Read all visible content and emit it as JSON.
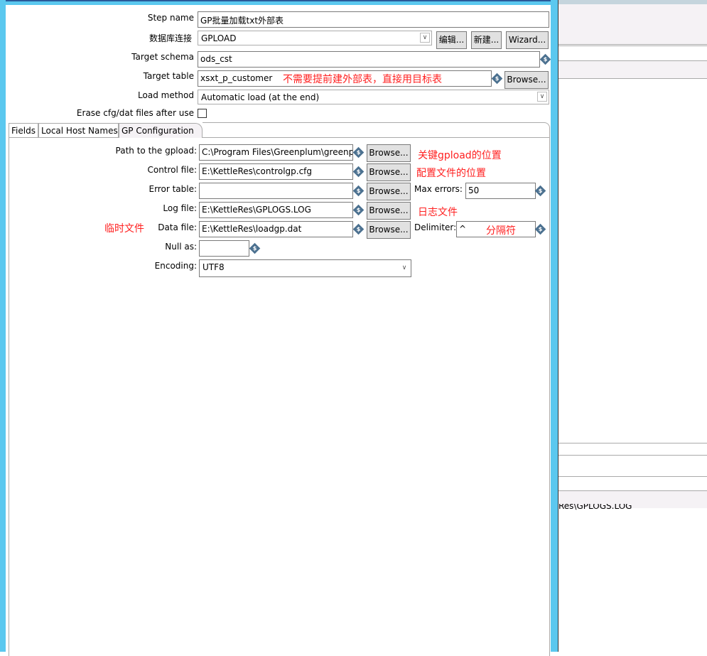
{
  "form": {
    "step_name_label": "Step name",
    "step_name": "GP批量加载txt外部表",
    "db_label": "数据库连接",
    "db_value": "GPLOAD",
    "edit_btn": "编辑...",
    "new_btn": "新建...",
    "wizard_btn": "Wizard...",
    "schema_label": "Target schema",
    "schema_value": "ods_cst",
    "table_label": "Target table",
    "table_value": "xsxt_p_customer",
    "browse": "Browse...",
    "load_label": "Load method",
    "load_value": "Automatic load (at the end)",
    "erase_label": "Erase cfg/dat files after use",
    "erase_checked": false
  },
  "tabs": [
    {
      "label": "Fields"
    },
    {
      "label": "Local Host Names"
    },
    {
      "label": "GP Configuration",
      "active": true
    }
  ],
  "gp": {
    "path_label": "Path to the gpload:",
    "path_value": "C:\\Program Files\\Greenplum\\greenp",
    "control_label": "Control file:",
    "control_value": "E:\\KettleRes\\controlgp.cfg",
    "error_label": "Error table:",
    "error_value": "",
    "max_errors_label": "Max errors:",
    "max_errors_value": "50",
    "log_label": "Log file:",
    "log_value": "E:\\KettleRes\\GPLOGS.LOG",
    "data_label": "Data file:",
    "data_value": "E:\\KettleRes\\loadgp.dat",
    "delimiter_label": "Delimiter:",
    "delimiter_value": "^",
    "null_label": "Null as:",
    "null_value": "",
    "encoding_label": "Encoding:",
    "encoding_value": "UTF8",
    "browse": "Browse..."
  },
  "annotations": {
    "table": "不需要提前建外部表，直接用目标表",
    "path": "关键gpload的位置",
    "control": "配置文件的位置",
    "log": "日志文件",
    "data": "临时文件",
    "delimiter": "分隔符"
  },
  "background": {
    "cut_text": "Res\\GPLOGS.LOG"
  },
  "colors": {
    "frame": "#5bc8ef",
    "annotation": "#ff2020",
    "variable_icon": "#4c7190"
  }
}
